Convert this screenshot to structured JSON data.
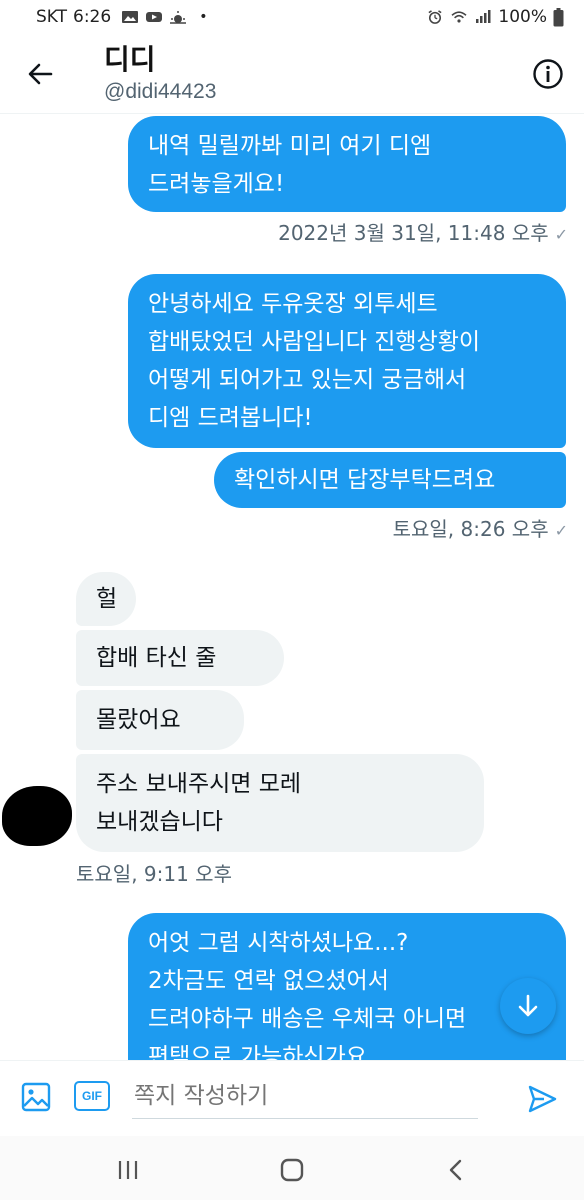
{
  "status_bar": {
    "carrier": "SKT",
    "time": "6:26",
    "battery": "100%"
  },
  "header": {
    "name": "디디",
    "handle": "@didi44423"
  },
  "messages": [
    {
      "lines": [
        "내역 밀릴까봐 미리 여기 디엠",
        "드려놓을게요!"
      ]
    },
    {
      "lines": [
        "안녕하세요 두유옷장 외투세트",
        "합배탔었던 사람입니다 진행상황이",
        "어떻게 되어가고 있는지 궁금해서",
        "디엠 드려봅니다!"
      ]
    },
    {
      "lines": [
        "확인하시면 답장부탁드려요"
      ]
    },
    {
      "lines": [
        "헐"
      ]
    },
    {
      "lines": [
        "합배 타신 줄"
      ]
    },
    {
      "lines": [
        "몰랐어요"
      ]
    },
    {
      "lines": [
        "주소 보내주시면 모레",
        "보내겠습니다"
      ]
    },
    {
      "lines": [
        "어엇 그럼 시착하셨나요...?",
        "2차금도 연락 없으셨어서",
        "드려야하구 배송은 우체국 아니면",
        "편택으로 가능하신가요"
      ]
    }
  ],
  "timestamps": [
    "2022년 3월 31일, 11:48 오후",
    "토요일, 8:26 오후",
    "토요일, 9:11 오후"
  ],
  "composer": {
    "placeholder": "쪽지 작성하기",
    "gif_label": "GIF"
  },
  "colors": {
    "accent": "#1d9bf0",
    "received_bubble": "#eff3f4"
  },
  "icons": [
    "back-arrow-icon",
    "info-icon",
    "image-icon",
    "gif-icon",
    "send-icon",
    "arrow-down-icon",
    "recent-apps-icon",
    "home-icon",
    "nav-back-icon"
  ]
}
